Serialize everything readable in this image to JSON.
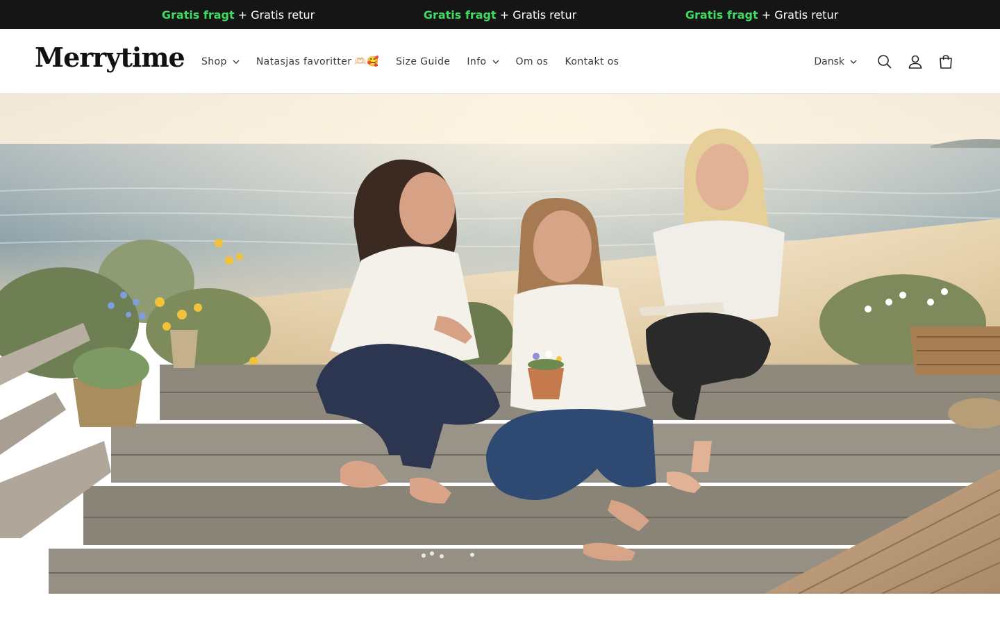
{
  "announcement": {
    "items": [
      {
        "highlight": "Gratis fragt",
        "rest": " + Gratis retur"
      },
      {
        "highlight": "Gratis fragt",
        "rest": " + Gratis retur"
      },
      {
        "highlight": "Gratis fragt",
        "rest": " + Gratis retur"
      }
    ]
  },
  "header": {
    "logo": "Merrytime",
    "nav": {
      "shop": "Shop",
      "favorites": "Natasjas favoritter",
      "favorites_emoji": "🫶🏻🥰",
      "size_guide": "Size Guide",
      "info": "Info",
      "about": "Om os",
      "contact": "Kontakt os"
    },
    "language": "Dansk",
    "icons": [
      "search-icon",
      "account-icon",
      "cart-icon"
    ]
  },
  "colors": {
    "announce_bg": "#151515",
    "announce_highlight": "#3ddc5f",
    "text": "#3a3a3a"
  }
}
